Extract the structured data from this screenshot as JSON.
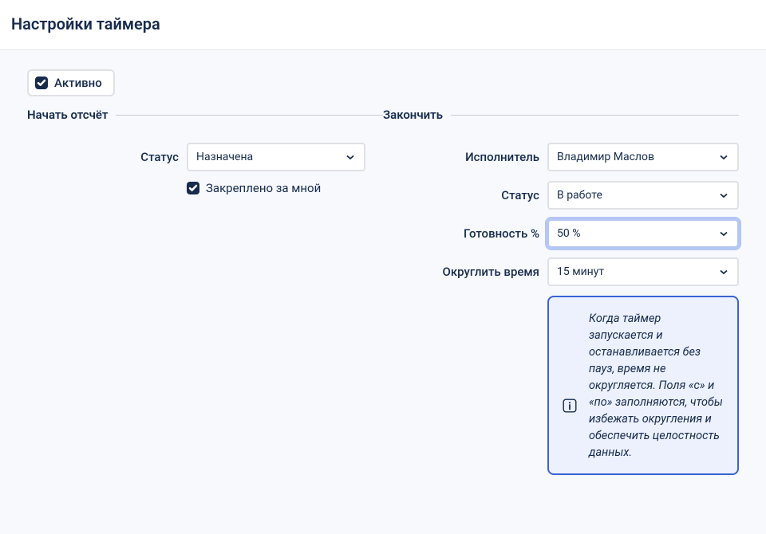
{
  "header": {
    "title": "Настройки таймера"
  },
  "active_toggle": {
    "label": "Активно",
    "checked": true
  },
  "groups": {
    "start": {
      "label": "Начать отсчёт"
    },
    "finish": {
      "label": "Закончить"
    }
  },
  "start": {
    "status": {
      "label": "Статус",
      "value": "Назначена"
    },
    "assigned_to_me": {
      "label": "Закреплено за мной",
      "checked": true
    }
  },
  "finish": {
    "assignee": {
      "label": "Исполнитель",
      "value": "Владимир Маслов"
    },
    "status": {
      "label": "Статус",
      "value": "В работе"
    },
    "readiness": {
      "label": "Готовность %",
      "value": "50 %"
    },
    "rounding": {
      "label": "Округлить время",
      "value": "15 минут"
    },
    "note": "Когда таймер запускается и останавливается без пауз, время не округляется. Поля «с» и «по» заполняются, чтобы избежать округления и обеспечить целостность данных."
  }
}
